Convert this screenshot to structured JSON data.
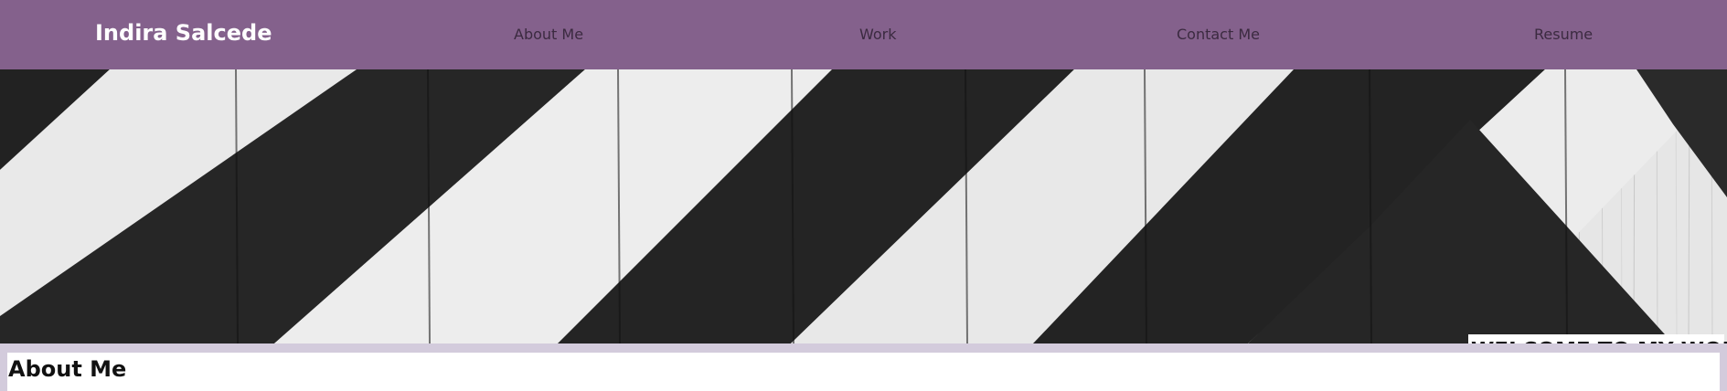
{
  "navbar": {
    "brand": "Indira Salcede",
    "links": [
      {
        "label": "About Me"
      },
      {
        "label": "Work"
      },
      {
        "label": "Contact Me"
      },
      {
        "label": "Resume"
      }
    ],
    "background_color": "#84618c"
  },
  "hero": {
    "welcome_text": "WELCOME TO MY WORLD",
    "image_description_icon": "striped-wood-image"
  },
  "about": {
    "heading": "About Me"
  },
  "colors": {
    "nav": "#84618c",
    "section_bg": "#d3cbdc"
  }
}
